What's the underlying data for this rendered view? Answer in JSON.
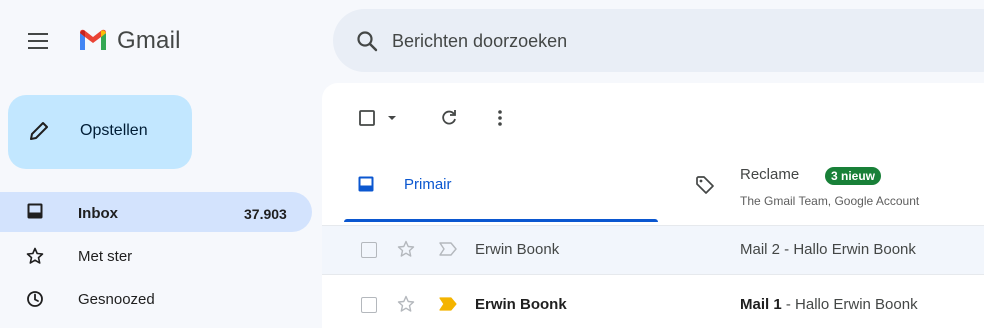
{
  "app": {
    "brand": "Gmail"
  },
  "search": {
    "placeholder": "Berichten doorzoeken"
  },
  "compose": {
    "label": "Opstellen"
  },
  "sidebar": {
    "items": [
      {
        "label": "Inbox",
        "count": "37.903",
        "icon": "inbox-icon",
        "active": true
      },
      {
        "label": "Met ster",
        "count": "",
        "icon": "star-icon",
        "active": false
      },
      {
        "label": "Gesnoozed",
        "count": "",
        "icon": "clock-icon",
        "active": false
      }
    ]
  },
  "tabs": [
    {
      "label": "Primair",
      "icon": "inbox-icon",
      "selected": true
    },
    {
      "label": "Reclame",
      "badge": "3 nieuw",
      "subtitle": "The Gmail Team, Google Account",
      "icon": "tag-icon",
      "selected": false
    }
  ],
  "emails": [
    {
      "sender": "Erwin Boonk",
      "subject": "Mail 2",
      "snippet": " - Hallo Erwin Boonk",
      "read": true,
      "important": false
    },
    {
      "sender": "Erwin Boonk",
      "subject": "Mail 1",
      "snippet": " - Hallo Erwin Boonk",
      "read": false,
      "important": true
    }
  ],
  "colors": {
    "accent": "#0b57d0",
    "compose_bg": "#c2e7ff",
    "active_nav": "#d3e3fd",
    "badge": "#188038",
    "important": "#f4b400"
  }
}
